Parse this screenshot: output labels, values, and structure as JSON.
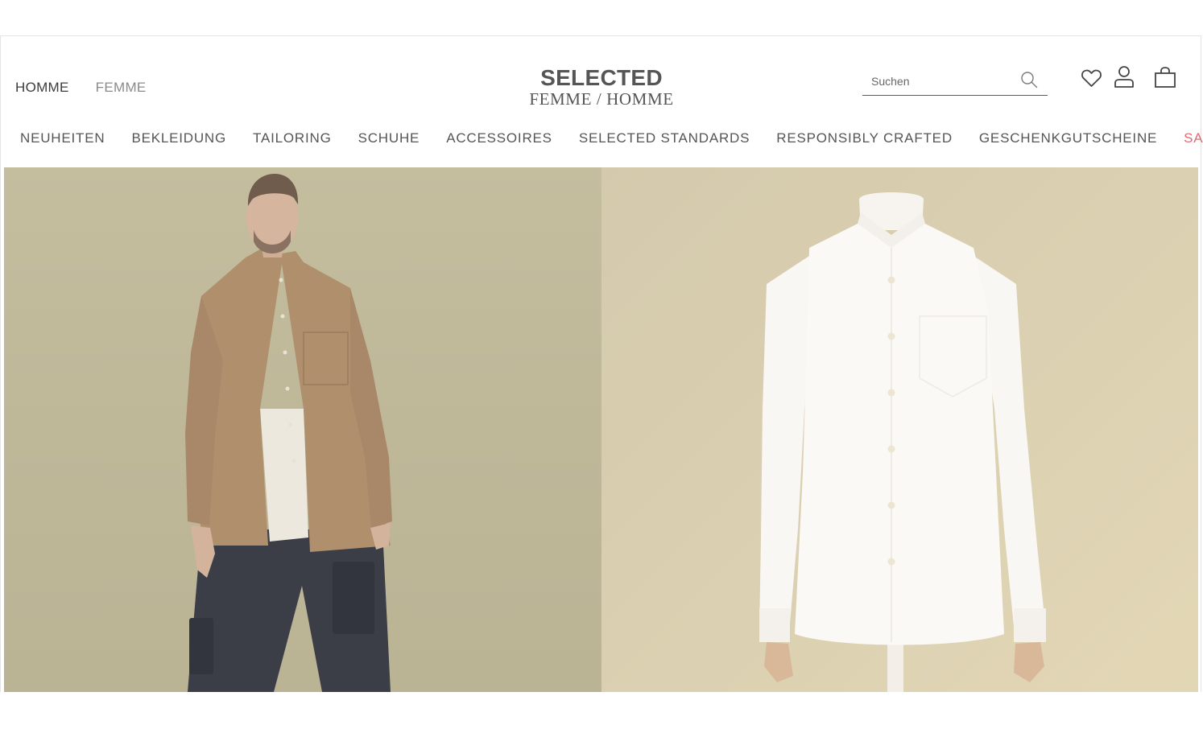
{
  "header": {
    "gender_tabs": [
      {
        "label": "HOMME",
        "active": true
      },
      {
        "label": "FEMME",
        "active": false
      }
    ],
    "logo": {
      "line1": "SELECTED",
      "line2": "FEMME / HOMME"
    },
    "search": {
      "placeholder": "Suchen",
      "value": ""
    },
    "icons": [
      "search-icon",
      "heart-icon",
      "account-icon",
      "bag-icon"
    ]
  },
  "nav": {
    "items": [
      "NEUHEITEN",
      "BEKLEIDUNG",
      "TAILORING",
      "SCHUHE",
      "ACCESSOIRES",
      "SELECTED STANDARDS",
      "RESPONSIBLY CRAFTED",
      "GESCHENKGUTSCHEINE",
      "SALE"
    ],
    "sale_color": "#e06a72"
  },
  "hero": {
    "panels": [
      "model-wearing-beige-shirt",
      "white-shirt-on-mannequin"
    ]
  },
  "colors": {
    "text": "#555555",
    "left_panel_bg": "#c0b999",
    "right_panel_bg": "#d6cba9"
  }
}
